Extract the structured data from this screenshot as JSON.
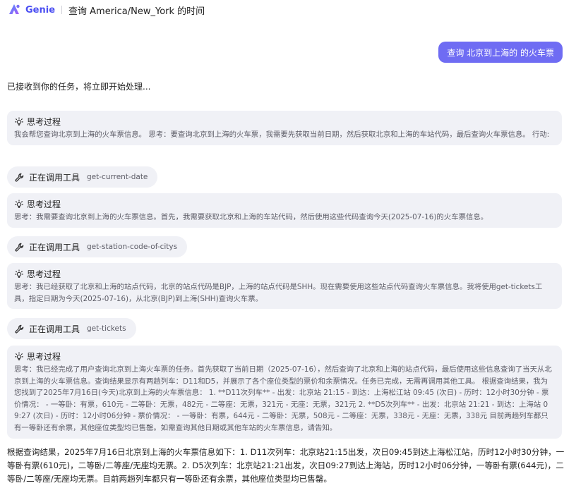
{
  "header": {
    "brand": "Genie",
    "title": "查询 America/New_York 的时间",
    "logo_icon": "genie-logo-icon",
    "colors": {
      "brand": "#4b4ff2",
      "user_bubble": "#6f6cf3",
      "card_bg": "#f0f1f6"
    }
  },
  "user_message": "查询 北京到上海的 的火车票",
  "ack_message": "已接收到你的任务，将立即开始处理...",
  "thinking_label": "思考过程",
  "tool_label": "正在调用工具",
  "steps": [
    {
      "type": "thinking",
      "text": "我会帮您查询北京到上海的火车票信息。 思考：要查询北京到上海的火车票，我需要先获取当前日期，然后获取北京和上海的车站代码，最后查询火车票信息。 行动:"
    },
    {
      "type": "tool",
      "name": "get-current-date"
    },
    {
      "type": "thinking",
      "text": "思考：我需要查询北京到上海的火车票信息。首先，我需要获取北京和上海的车站代码，然后使用这些代码查询今天(2025-07-16)的火车票信息。"
    },
    {
      "type": "tool",
      "name": "get-station-code-of-citys"
    },
    {
      "type": "thinking",
      "text": "思考：我已经获取了北京和上海的站点代码，北京的站点代码是BJP，上海的站点代码是SHH。现在需要使用这些站点代码查询火车票信息。我将使用get-tickets工具，指定日期为今天(2025-07-16)，从北京(BJP)到上海(SHH)查询火车票。"
    },
    {
      "type": "tool",
      "name": "get-tickets"
    },
    {
      "type": "thinking",
      "text": "思考：我已经完成了用户查询北京到上海火车票的任务。首先获取了当前日期（2025-07-16），然后查询了北京和上海的站点代码，最后使用这些信息查询了当天从北京到上海的火车票信息。查询结果显示有两趟列车：D11和D5，并展示了各个座位类型的票价和余票情况。任务已完成，无需再调用其他工具。 根据查询结果，我为您找到了2025年7月16日(今天)北京到上海的火车票信息： 1. **D11次列车** - 出发：北京站 21:15 - 到达：上海松江站 09:45 (次日) - 历时：12小时30分钟 - 票价情况： - 一等卧：有票，610元 - 二等卧：无票，482元 - 二等座：无票，321元 - 无座：无票，321元 2. **D5次列车** - 出发：北京站 21:21 - 到达：上海站 09:27 (次日) - 历时：12小时06分钟 - 票价情况： - 一等卧：有票，644元 - 二等卧：无票，508元 - 二等座：无票，338元 - 无座：无票，338元 目前两趟列车都只有一等卧还有余票，其他座位类型均已售罄。如需查询其他日期或其他车站的火车票信息，请告知。"
    }
  ],
  "final_answer": "根据查询结果，2025年7月16日北京到上海的火车票信息如下：1. D11次列车：北京站21:15出发，次日09:45到达上海松江站，历时12小时30分钟，一等卧有票(610元)，二等卧/二等座/无座均无票。2. D5次列车：北京站21:21出发，次日09:27到达上海站，历时12小时06分钟，一等卧有票(644元)，二等卧/二等座/无座均无票。目前两趟列车都只有一等卧还有余票，其他座位类型均已售罄。"
}
